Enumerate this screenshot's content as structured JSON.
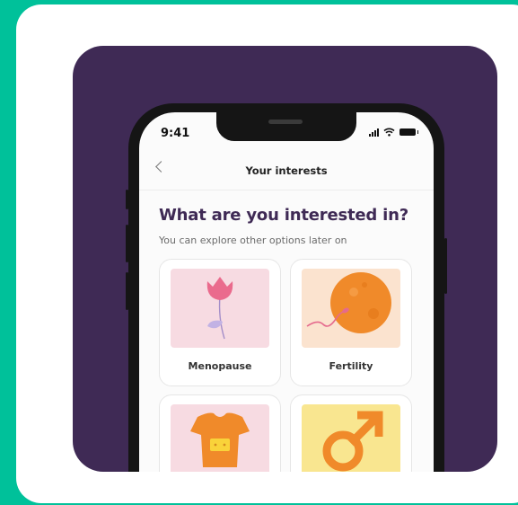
{
  "status_bar": {
    "time": "9:41"
  },
  "nav": {
    "title": "Your interests"
  },
  "page": {
    "heading": "What are you interested in?",
    "subheading": "You can explore other options later on"
  },
  "options": [
    {
      "label": "Menopause",
      "icon": "tulip-icon",
      "bg": "#f7dbe2"
    },
    {
      "label": "Fertility",
      "icon": "egg-sperm-icon",
      "bg": "#fbe3cf"
    },
    {
      "label": "",
      "icon": "baby-onesie-icon",
      "bg": "#f7dbe2"
    },
    {
      "label": "",
      "icon": "male-symbol-icon",
      "bg": "#f9e690"
    }
  ],
  "colors": {
    "background": "#00c19a",
    "panel": "#3f2a55",
    "accent_orange": "#f08a2a",
    "accent_pink": "#e56a8d"
  }
}
